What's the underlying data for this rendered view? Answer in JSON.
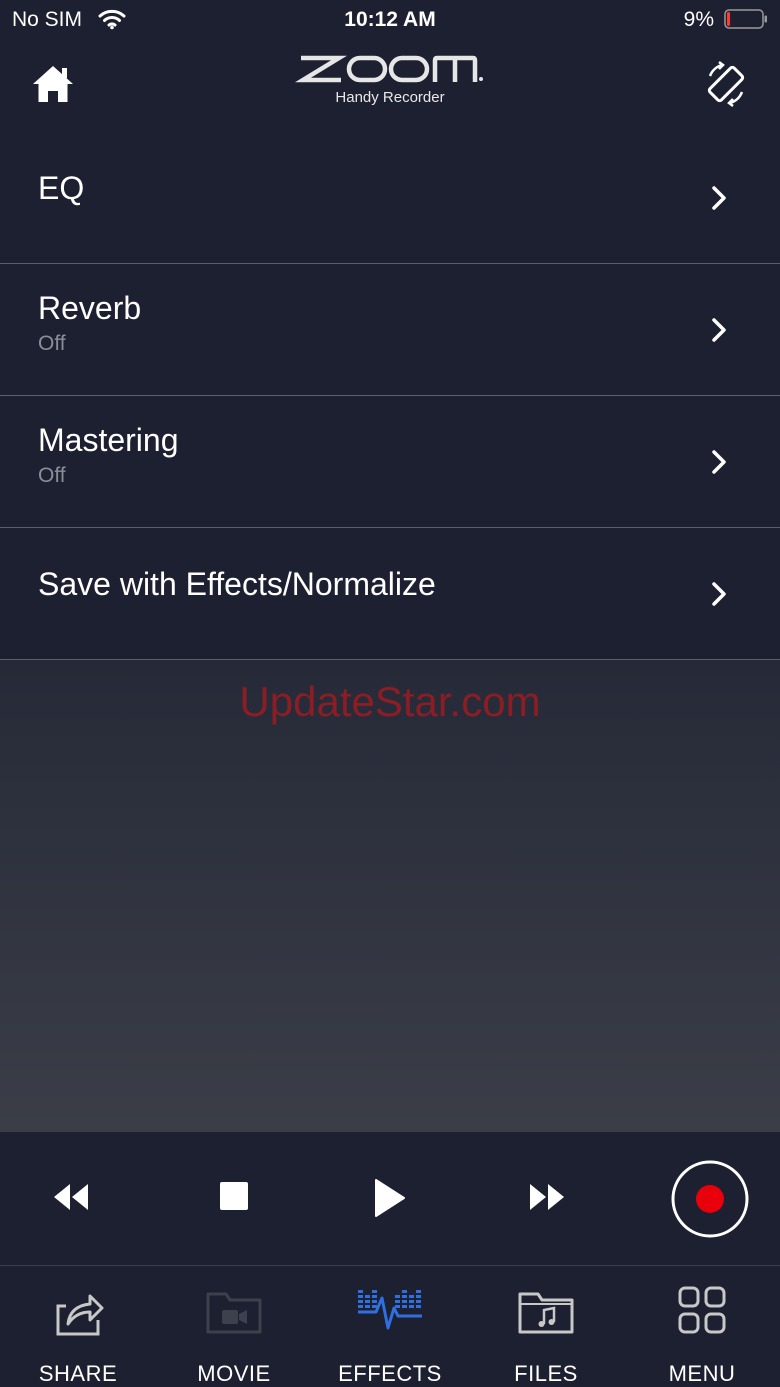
{
  "status_bar": {
    "carrier": "No SIM",
    "time": "10:12 AM",
    "battery_percent": "9%",
    "battery_level": 0.09,
    "battery_color": "#ff3b30"
  },
  "header": {
    "logo_text": "ZOOM",
    "logo_subtitle": "Handy Recorder",
    "home_icon": "home-icon",
    "rotate_icon": "screen-rotation-icon"
  },
  "effects_list": [
    {
      "title": "EQ",
      "subtitle": ""
    },
    {
      "title": "Reverb",
      "subtitle": "Off"
    },
    {
      "title": "Mastering",
      "subtitle": "Off"
    },
    {
      "title": "Save with Effects/Normalize",
      "subtitle": ""
    }
  ],
  "watermark": "UpdateStar.com",
  "transport": {
    "icons": [
      "rewind-icon",
      "stop-icon",
      "play-icon",
      "fast-forward-icon",
      "record-icon"
    ],
    "record_color": "#e8000b"
  },
  "tabs": [
    {
      "label": "SHARE",
      "icon": "share-icon",
      "active": false,
      "disabled": false
    },
    {
      "label": "MOVIE",
      "icon": "movie-folder-icon",
      "active": false,
      "disabled": true
    },
    {
      "label": "EFFECTS",
      "icon": "effects-waveform-icon",
      "active": true,
      "disabled": false
    },
    {
      "label": "FILES",
      "icon": "music-folder-icon",
      "active": false,
      "disabled": false
    },
    {
      "label": "MENU",
      "icon": "grid-menu-icon",
      "active": false,
      "disabled": false
    }
  ],
  "colors": {
    "background": "#1c2030",
    "accent": "#2f6fe0",
    "divider": "#5a5f6b",
    "subtitle": "#8a8e99"
  }
}
